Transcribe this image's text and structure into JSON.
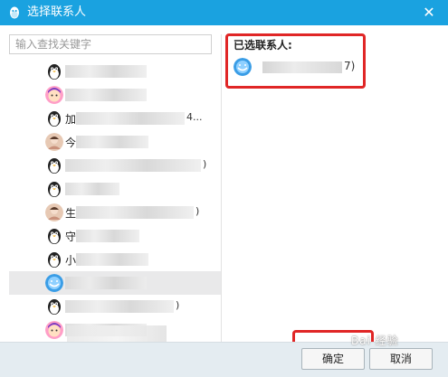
{
  "window": {
    "title": "选择联系人"
  },
  "search": {
    "placeholder": "输入查找关键字"
  },
  "contacts": [
    {
      "visible": "",
      "tail": "",
      "avatar": "penguin",
      "mask_w": 90
    },
    {
      "visible": "",
      "tail": "",
      "avatar": "cartoon",
      "mask_w": 90
    },
    {
      "visible": "加",
      "tail": "4...",
      "avatar": "penguin",
      "mask_w": 120
    },
    {
      "visible": "今",
      "tail": "",
      "avatar": "photo",
      "mask_w": 80
    },
    {
      "visible": "",
      "tail": ")",
      "avatar": "penguin",
      "mask_w": 150
    },
    {
      "visible": "",
      "tail": "",
      "avatar": "penguin",
      "mask_w": 60
    },
    {
      "visible": "生",
      "tail": ")",
      "avatar": "photo",
      "mask_w": 130
    },
    {
      "visible": "守",
      "tail": "",
      "avatar": "penguin",
      "mask_w": 70
    },
    {
      "visible": "小",
      "tail": "",
      "avatar": "penguin",
      "mask_w": 80
    },
    {
      "visible": "",
      "tail": "",
      "avatar": "smiley",
      "mask_w": 90
    },
    {
      "visible": "",
      "tail": ")",
      "avatar": "penguin",
      "mask_w": 120
    },
    {
      "visible": "",
      "tail": "",
      "avatar": "cartoon",
      "mask_w": 90
    }
  ],
  "selected": {
    "title": "已选联系人:",
    "items": [
      {
        "tail": "7)",
        "avatar": "smiley"
      }
    ]
  },
  "footer": {
    "ok_label": "确定",
    "cancel_label": "取消"
  },
  "watermark": {
    "text": "Bai 经验"
  },
  "colors": {
    "titlebar": "#1aa2e0",
    "annotation": "#e02626",
    "footer": "#e4ecf1"
  }
}
